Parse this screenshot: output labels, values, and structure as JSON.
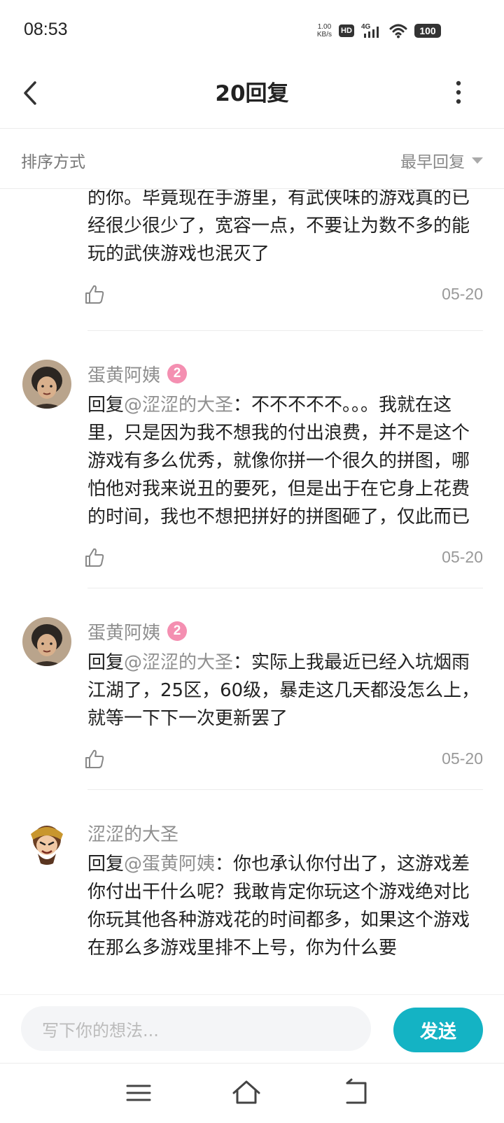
{
  "status_bar": {
    "time": "08:53",
    "net_speed_value": "1.00",
    "net_speed_unit": "KB/s",
    "hd": "HD",
    "network": "4G",
    "battery": "100"
  },
  "header": {
    "title": "20回复",
    "back_icon": "chevron-left-icon",
    "more_icon": "more-vertical-icon"
  },
  "sort": {
    "label": "排序方式",
    "selected": "最早回复"
  },
  "replies": [
    {
      "partial": true,
      "text": "的你。毕竟现在手游里，有武侠味的游戏真的已经很少很少了，宽容一点，不要让为数不多的能玩的武侠游戏也泯灭了",
      "date": "05-20"
    },
    {
      "name": "蛋黄阿姨",
      "level": "2",
      "reply_prefix": "回复",
      "mention": "@涩涩的大圣",
      "text": "：不不不不不。。。我就在这里，只是因为我不想我的付出浪费，并不是这个游戏有多么优秀，就像你拼一个很久的拼图，哪怕他对我来说丑的要死，但是出于在它身上花费的时间，我也不想把拼好的拼图砸了，仅此而已",
      "date": "05-20"
    },
    {
      "name": "蛋黄阿姨",
      "level": "2",
      "reply_prefix": "回复",
      "mention": "@涩涩的大圣",
      "text": "：实际上我最近已经入坑烟雨江湖了，25区，60级，暴走这几天都没怎么上，就等一下下一次更新罢了",
      "date": "05-20"
    },
    {
      "name": "涩涩的大圣",
      "reply_prefix": "回复",
      "mention": "@蛋黄阿姨",
      "text": "：你也承认你付出了，这游戏差你付出干什么呢？我敢肯定你玩这个游戏绝对比你玩其他各种游戏花的时间都多，如果这个游戏在那么多游戏里排不上号，你为什么要"
    }
  ],
  "composer": {
    "placeholder": "写下你的想法...",
    "send_label": "发送"
  },
  "colors": {
    "accent": "#14b3c4",
    "badge": "#f48fb1",
    "muted_text": "#8f8f8f"
  }
}
